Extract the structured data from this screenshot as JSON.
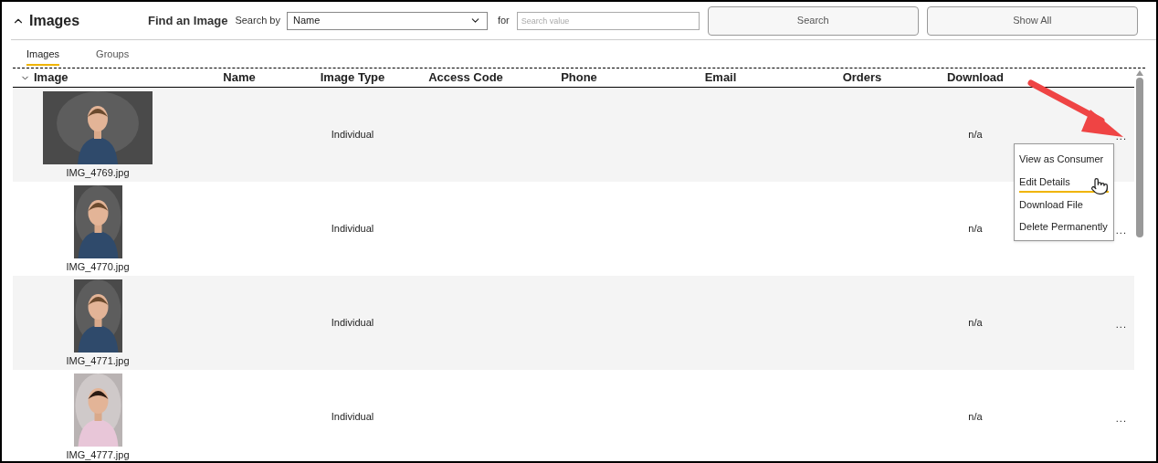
{
  "header": {
    "title": "Images",
    "expanded": true,
    "find_label": "Find an Image",
    "search_by_label": "Search by",
    "search_by_value": "Name",
    "for_label": "for",
    "search_placeholder": "Search value",
    "buttons": [
      "Search",
      "Show All"
    ]
  },
  "tabs": [
    {
      "label": "Images",
      "selected": true
    },
    {
      "label": "Groups",
      "selected": false
    }
  ],
  "table": {
    "columns": [
      "Image",
      "Name",
      "Image Type",
      "Access Code",
      "Phone",
      "Email",
      "Orders",
      "Download"
    ],
    "rows": [
      {
        "file": "IMG_4769.jpg",
        "image_type": "Individual",
        "download": "n/a",
        "actions": "...",
        "menu_open": true
      },
      {
        "file": "IMG_4770.jpg",
        "image_type": "Individual",
        "download": "n/a",
        "actions": "...",
        "menu_open": false
      },
      {
        "file": "IMG_4771.jpg",
        "image_type": "Individual",
        "download": "n/a",
        "actions": "...",
        "menu_open": false
      },
      {
        "file": "IMG_4777.jpg",
        "image_type": "Individual",
        "download": "n/a",
        "actions": "...",
        "menu_open": false
      }
    ]
  },
  "row_menu": [
    {
      "label": "View as Consumer",
      "selected": false
    },
    {
      "label": "Edit Details",
      "selected": true
    },
    {
      "label": "Download File",
      "selected": false
    },
    {
      "label": "Delete Permanently",
      "selected": false
    }
  ]
}
